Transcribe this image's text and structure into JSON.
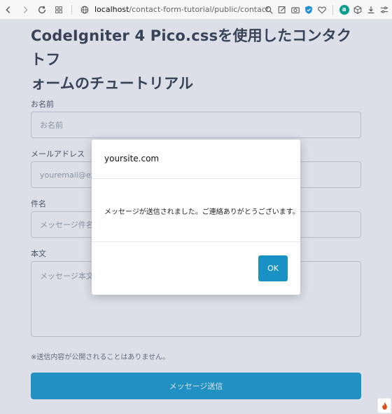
{
  "browser": {
    "url_host": "localhost",
    "url_path": "/contact-form-tutorial/public/contact"
  },
  "page": {
    "title_line1": "CodeIgniter 4 Pico.cssを使用したコンタクトフ",
    "title_line2": "ォームのチュートリアル",
    "fields": [
      {
        "label": "お名前",
        "placeholder": "お名前"
      },
      {
        "label": "メールアドレス",
        "placeholder": "youremail@example.com"
      },
      {
        "label": "件名",
        "placeholder": "メッセージ件名"
      },
      {
        "label": "本文",
        "placeholder": "メッセージ本文"
      }
    ],
    "note": "※送信内容が公開されることはありません。",
    "submit_label": "メッセージ送信"
  },
  "dialog": {
    "site": "yoursite.com",
    "message": "メッセージが送信されました。ご連絡ありがとうございます。",
    "ok_label": "OK"
  }
}
